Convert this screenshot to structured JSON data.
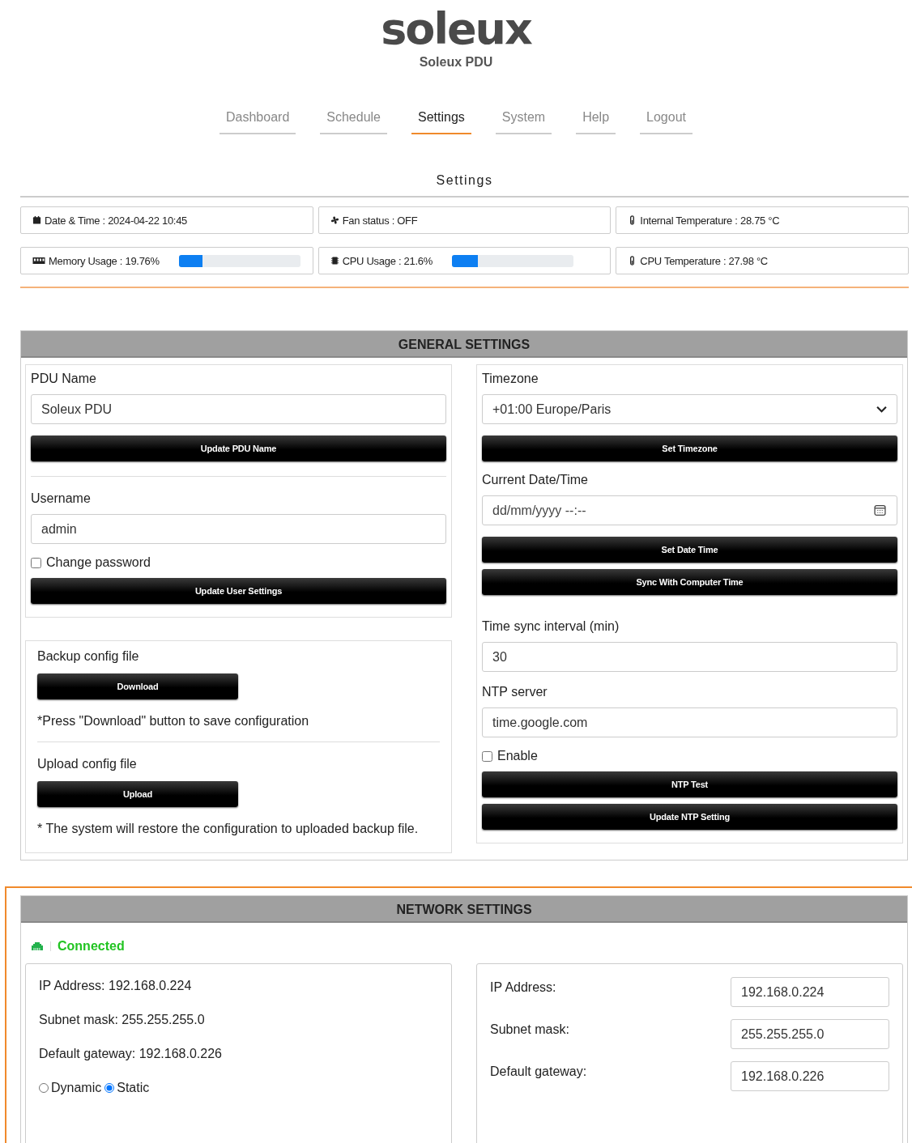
{
  "logo": {
    "wordmark": "soleux",
    "subtitle": "Soleux PDU"
  },
  "nav": [
    {
      "label": "Dashboard",
      "selected": false
    },
    {
      "label": "Schedule",
      "selected": false
    },
    {
      "label": "Settings",
      "selected": true
    },
    {
      "label": "System",
      "selected": false
    },
    {
      "label": "Help",
      "selected": false
    },
    {
      "label": "Logout",
      "selected": false
    }
  ],
  "page_title": "Settings",
  "status": [
    {
      "kind": "calendar",
      "text": "Date & Time : 2024-04-22 10:45"
    },
    {
      "kind": "fan",
      "text": "Fan status : OFF"
    },
    {
      "kind": "thermometer",
      "text": "Internal Temperature : 28.75 °C"
    },
    {
      "kind": "memory",
      "text": "Memory Usage : 19.76%",
      "level": 0.1976
    },
    {
      "kind": "cpu",
      "text": "CPU Usage : 21.6%",
      "level": 0.216
    },
    {
      "kind": "thermometer",
      "text": "CPU Temperature : 27.98 °C"
    }
  ],
  "general": {
    "title": "GENERAL SETTINGS",
    "pdu_name": {
      "label": "PDU Name",
      "value": "Soleux PDU",
      "button": "Update PDU Name"
    },
    "username": {
      "label": "Username",
      "value": "admin"
    },
    "change_password": {
      "label": "Change password",
      "checked": false
    },
    "user_button": "Update User Settings",
    "backup": {
      "label": "Backup config file",
      "button": "Download",
      "note": "*Press \"Download\" button to save configuration"
    },
    "upload": {
      "label": "Upload config file",
      "button": "Upload",
      "note": "* The system will restore the configuration to uploaded backup file."
    },
    "timezone": {
      "label": "Timezone",
      "value": "+01:00 Europe/Paris",
      "button": "Set Timezone"
    },
    "current_datetime": {
      "label": "Current Date/Time",
      "placeholder": "dd/mm/yyyy --:--",
      "buttons": [
        "Set Date Time",
        "Sync With Computer Time"
      ]
    },
    "sync_interval": {
      "label": "Time sync interval (min)",
      "value": "30"
    },
    "ntp_server": {
      "label": "NTP server",
      "value": "time.google.com"
    },
    "ntp_enable": {
      "label": "Enable",
      "checked": false
    },
    "ntp_buttons": [
      "NTP Test",
      "Update NTP Setting"
    ]
  },
  "network": {
    "title": "NETWORK SETTINGS",
    "status": "Connected",
    "info": [
      "IP Address: 192.168.0.224",
      "Subnet mask: 255.255.255.0",
      "Default gateway: 192.168.0.226"
    ],
    "mode": [
      {
        "label": "Dynamic",
        "selected": false
      },
      {
        "label": "Static",
        "selected": true
      }
    ],
    "fields": [
      {
        "label": "IP Address:",
        "value": "192.168.0.224"
      },
      {
        "label": "Subnet mask:",
        "value": "255.255.255.0"
      },
      {
        "label": "Default gateway:",
        "value": "192.168.0.226"
      }
    ]
  }
}
